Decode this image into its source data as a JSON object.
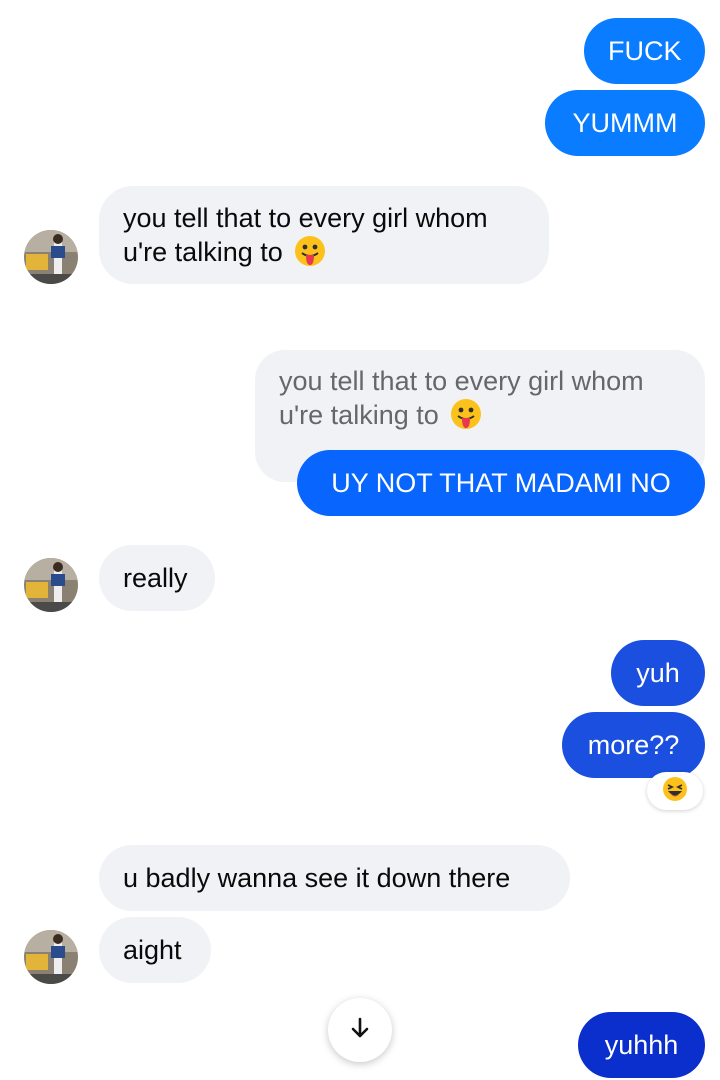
{
  "colors": {
    "sent_blue": "#0a7cff",
    "sent_blue_dark": "#0866ff",
    "sent_indigo": "#1a4fe0",
    "sent_deep": "#0a2fcc",
    "received_bg": "#f0f2f5",
    "quote_text": "#65676b"
  },
  "messages": {
    "m1": "FUCK",
    "m2": "YUMMM",
    "m3": "you tell that to every girl whom",
    "m3b": "u're talking to",
    "quote_line1": "you tell that to every girl whom",
    "quote_line2": "u're talking to",
    "m4": "UY NOT THAT MADAMI NO",
    "m5": "really",
    "m6": "yuh",
    "m7": "more??",
    "m8": "u badly wanna see it down there",
    "m9": "aight",
    "m10": "yuhhh"
  },
  "icons": {
    "tongue_emoji": "face-with-tongue-icon",
    "laugh_reaction": "laughing-face-icon",
    "scroll_down": "arrow-down-icon",
    "avatar": "contact-avatar"
  }
}
